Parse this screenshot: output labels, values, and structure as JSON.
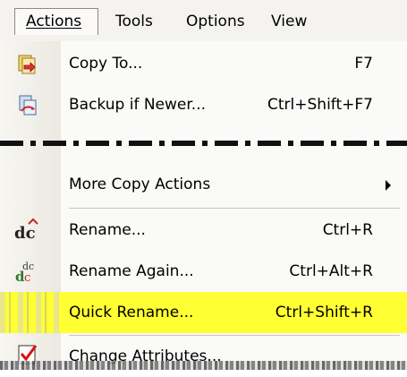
{
  "menubar": {
    "items": [
      {
        "label": "Actions"
      },
      {
        "label": "Tools"
      },
      {
        "label": "Options"
      },
      {
        "label": "View"
      }
    ]
  },
  "menu": {
    "copy_to": {
      "label": "Copy To...",
      "shortcut": "F7",
      "icon": "copy-to-icon"
    },
    "backup": {
      "label": "Backup if Newer...",
      "shortcut": "Ctrl+Shift+F7",
      "icon": "backup-icon"
    },
    "more_copy": {
      "label": "More Copy Actions",
      "icon": "submenu-arrow-icon"
    },
    "rename": {
      "label": "Rename...",
      "shortcut": "Ctrl+R",
      "icon": "rename-icon"
    },
    "rename_again": {
      "label": "Rename Again...",
      "shortcut": "Ctrl+Alt+R",
      "icon": "rename-again-icon"
    },
    "quick_rename": {
      "label": "Quick Rename...",
      "shortcut": "Ctrl+Shift+R",
      "highlight_color": "#ffff33"
    },
    "change_attributes": {
      "label": "Change Attributes...",
      "icon": "change-attributes-icon"
    }
  }
}
